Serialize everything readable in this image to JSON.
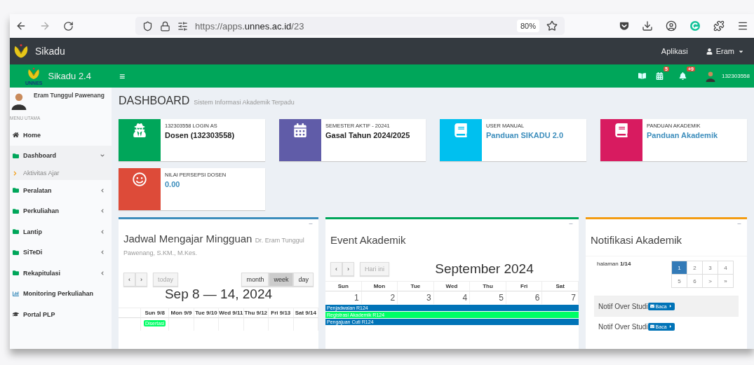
{
  "browser": {
    "url_prefix": "https://apps.",
    "url_domain": "unnes.ac.id",
    "url_path": "/23",
    "zoom": "80%"
  },
  "topbar": {
    "brand": "Sikadu",
    "menu": "Aplikasi",
    "user": "Eram"
  },
  "navbar": {
    "brand": "Sikadu 2.4",
    "logo_text": "UNNES",
    "menu_glyph": "≡",
    "badges": [
      {
        "kind": "book"
      },
      {
        "kind": "calendar",
        "count": "5"
      },
      {
        "kind": "bell",
        "count": "+9"
      }
    ],
    "user_id": "132303558"
  },
  "sidebar": {
    "user_name": "Eram Tunggul Pawenang",
    "section": "MENU UTAMA",
    "items": [
      {
        "label": "Home",
        "kind": "home"
      },
      {
        "label": "Dashboard",
        "kind": "folder",
        "expandable": true,
        "expanded": true,
        "children": [
          {
            "label": "Aktivitas Ajar"
          }
        ]
      },
      {
        "label": "Peralatan",
        "kind": "folder",
        "expandable": true,
        "expanded": false
      },
      {
        "label": "Perkuliahan",
        "kind": "folder",
        "expandable": true,
        "expanded": false
      },
      {
        "label": "Lantip",
        "kind": "folder",
        "expandable": true,
        "expanded": false
      },
      {
        "label": "SiTeDi",
        "kind": "folder",
        "expandable": true,
        "expanded": false
      },
      {
        "label": "Rekapitulasi",
        "kind": "folder",
        "expandable": true,
        "expanded": false
      },
      {
        "label": "Monitoring Perkuliahan",
        "kind": "chart"
      },
      {
        "label": "Portal PLP",
        "kind": "cap"
      }
    ]
  },
  "page": {
    "title": "DASHBOARD",
    "subtitle": "Sistem Informasi Akademik Terpadu"
  },
  "info_boxes": [
    {
      "kind": "spy",
      "color": "#00a65a",
      "label": "132303558 LOGIN AS",
      "value": "Dosen (132303558)",
      "link": false
    },
    {
      "kind": "calendar",
      "color": "#605ca8",
      "label": "SEMESTER AKTIF - 20241",
      "value": "Gasal Tahun 2024/2025",
      "link": false
    },
    {
      "kind": "book",
      "color": "#00c0ef",
      "label": "USER MANUAL",
      "value": "Panduan SIKADU 2.0",
      "link": true
    },
    {
      "kind": "book",
      "color": "#d81b60",
      "label": "PANDUAN AKADEMIK",
      "value": "Panduan Akademik",
      "link": true
    },
    {
      "kind": "smile",
      "color": "#dd4b39",
      "label": "NILAI PERSEPSI DOSEN",
      "value": "0.00",
      "link": true
    }
  ],
  "jadwal": {
    "title": "Jadwal Mengajar Mingguan",
    "subtitle": "Dr. Eram Tunggul Pawenang, S.KM., M.Kes.",
    "collapse": "−",
    "prev": "‹",
    "next": "›",
    "today": "today",
    "views": [
      {
        "label": "month",
        "selected": false
      },
      {
        "label": "week",
        "selected": true
      },
      {
        "label": "day",
        "selected": false
      }
    ],
    "range": "Sep 8 — 14, 2024",
    "columns": [
      {
        "label": "Sun 9/8",
        "events": [
          {
            "label": "Disertasi",
            "color": "#00ff66"
          }
        ]
      },
      {
        "label": "Mon 9/9"
      },
      {
        "label": "Tue 9/10"
      },
      {
        "label": "Wed 9/11"
      },
      {
        "label": "Thu 9/12"
      },
      {
        "label": "Fri 9/13"
      },
      {
        "label": "Sat 9/14"
      }
    ]
  },
  "event": {
    "title": "Event Akademik",
    "collapse": "−",
    "prev": "‹",
    "next": "›",
    "today": "Hari ini",
    "month": "September 2024",
    "weekdays": [
      "Sun",
      "Mon",
      "Tue",
      "Wed",
      "Thu",
      "Fri",
      "Sat"
    ],
    "days": [
      "1",
      "2",
      "3",
      "4",
      "5",
      "6",
      "7"
    ],
    "events": [
      {
        "label": "Penjadwalan R124",
        "color": "#0073b7"
      },
      {
        "label": "Registrasi Akademik R124",
        "color": "#00ff66"
      },
      {
        "label": "Pengajuan Cuti R124",
        "color": "#0073b7"
      }
    ]
  },
  "notif": {
    "title": "Notifikasi Akademik",
    "collapse": "−",
    "page_info": "halaman **1/14**",
    "pages": [
      {
        "label": "1",
        "selected": true
      },
      {
        "label": "2",
        "selected": false
      },
      {
        "label": "3",
        "selected": false
      },
      {
        "label": "4",
        "selected": false
      },
      {
        "label": "5",
        "selected": false
      },
      {
        "label": "6",
        "selected": false
      },
      {
        "label": ">",
        "selected": false
      },
      {
        "label": "»",
        "selected": false
      }
    ],
    "items": [
      {
        "title": "Notif Over Studi",
        "button": "Baca"
      },
      {
        "title": "Notif Over Studi",
        "button": "Baca"
      }
    ]
  }
}
